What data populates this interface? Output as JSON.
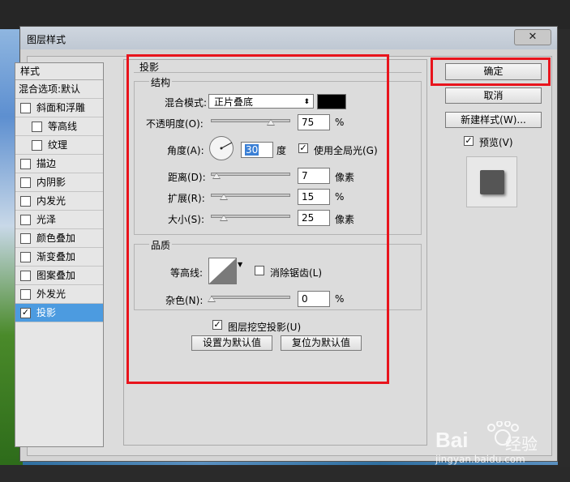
{
  "window": {
    "title": "图层样式",
    "close_symbol": "✕"
  },
  "sidebar": {
    "header": "样式",
    "items": [
      {
        "label": "混合选项:默认",
        "checkbox": false,
        "checked": false,
        "indent": false,
        "active": false
      },
      {
        "label": "斜面和浮雕",
        "checkbox": true,
        "checked": false,
        "indent": false,
        "active": false
      },
      {
        "label": "等高线",
        "checkbox": true,
        "checked": false,
        "indent": true,
        "active": false
      },
      {
        "label": "纹理",
        "checkbox": true,
        "checked": false,
        "indent": true,
        "active": false
      },
      {
        "label": "描边",
        "checkbox": true,
        "checked": false,
        "indent": false,
        "active": false
      },
      {
        "label": "内阴影",
        "checkbox": true,
        "checked": false,
        "indent": false,
        "active": false
      },
      {
        "label": "内发光",
        "checkbox": true,
        "checked": false,
        "indent": false,
        "active": false
      },
      {
        "label": "光泽",
        "checkbox": true,
        "checked": false,
        "indent": false,
        "active": false
      },
      {
        "label": "颜色叠加",
        "checkbox": true,
        "checked": false,
        "indent": false,
        "active": false
      },
      {
        "label": "渐变叠加",
        "checkbox": true,
        "checked": false,
        "indent": false,
        "active": false
      },
      {
        "label": "图案叠加",
        "checkbox": true,
        "checked": false,
        "indent": false,
        "active": false
      },
      {
        "label": "外发光",
        "checkbox": true,
        "checked": false,
        "indent": false,
        "active": false
      },
      {
        "label": "投影",
        "checkbox": true,
        "checked": true,
        "indent": false,
        "active": true
      }
    ]
  },
  "drop_shadow": {
    "section_title": "投影",
    "structure": {
      "title": "结构",
      "blend_mode_label": "混合模式:",
      "blend_mode_value": "正片叠底",
      "color": "#000000",
      "opacity_label": "不透明度(O):",
      "opacity_value": "75",
      "opacity_unit": "%",
      "angle_label": "角度(A):",
      "angle_value": "30",
      "angle_unit": "度",
      "global_light_label": "使用全局光(G)",
      "global_light_checked": true,
      "distance_label": "距离(D):",
      "distance_value": "7",
      "distance_unit": "像素",
      "spread_label": "扩展(R):",
      "spread_value": "15",
      "spread_unit": "%",
      "size_label": "大小(S):",
      "size_value": "25",
      "size_unit": "像素"
    },
    "quality": {
      "title": "品质",
      "contour_label": "等高线:",
      "antialias_label": "消除锯齿(L)",
      "antialias_checked": false,
      "noise_label": "杂色(N):",
      "noise_value": "0",
      "noise_unit": "%"
    },
    "knockout_label": "图层挖空投影(U)",
    "knockout_checked": true,
    "set_default_label": "设置为默认值",
    "reset_default_label": "复位为默认值"
  },
  "actions": {
    "ok_label": "确定",
    "cancel_label": "取消",
    "new_style_label": "新建样式(W)...",
    "preview_label": "预览(V)",
    "preview_checked": true
  },
  "watermark": {
    "brand": "Bai",
    "brand_suffix": "经验",
    "url": "jingyan.baidu.com"
  },
  "colors": {
    "highlight": "#e8141c",
    "selection": "#4c9be0"
  }
}
